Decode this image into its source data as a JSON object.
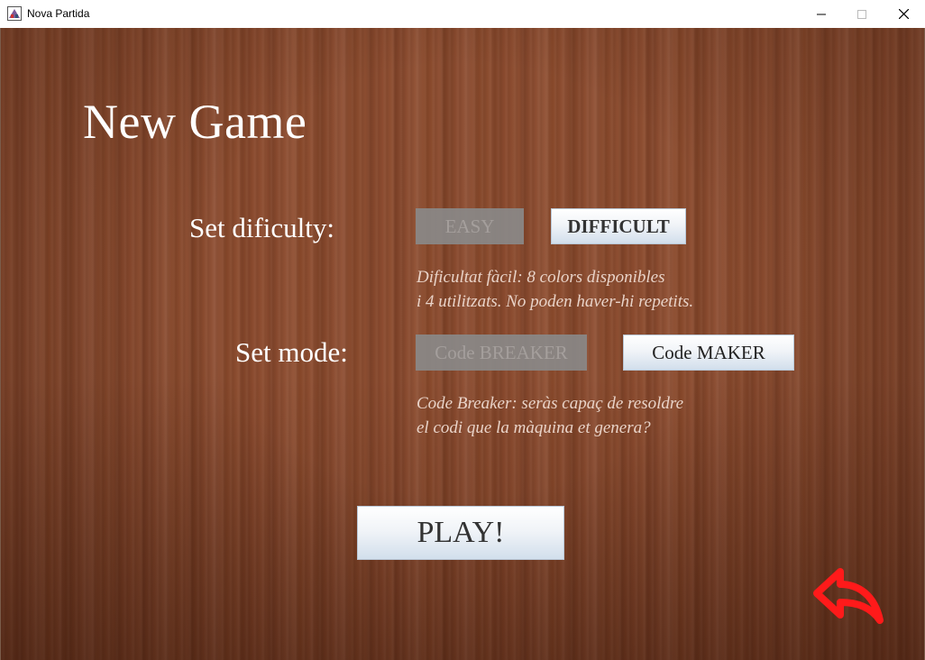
{
  "window": {
    "title": "Nova Partida",
    "controls": {
      "minimize": "minimize-icon",
      "maximize": "maximize-icon",
      "close": "close-icon"
    }
  },
  "colors": {
    "wood_background": "#8a4a2e",
    "accent_red": "#ff1a1a",
    "button_disabled": "#8a8a8a",
    "text_white": "#ffffff"
  },
  "main": {
    "title": "New Game",
    "difficulty": {
      "label": "Set dificulty:",
      "easy_label": "EASY",
      "difficult_label": "DIFFICULT",
      "selected": "EASY",
      "description_line1": "Dificultat fàcil: 8 colors disponibles",
      "description_line2": "i 4 utilitzats. No poden haver-hi repetits."
    },
    "mode": {
      "label": "Set mode:",
      "breaker_label": "Code BREAKER",
      "maker_label": "Code MAKER",
      "selected": "Code BREAKER",
      "description_line1": "Code Breaker: seràs capaç de resoldre",
      "description_line2": "el codi que la màquina et genera?"
    },
    "play_label": "PLAY!",
    "back_icon": "back-arrow-icon"
  }
}
